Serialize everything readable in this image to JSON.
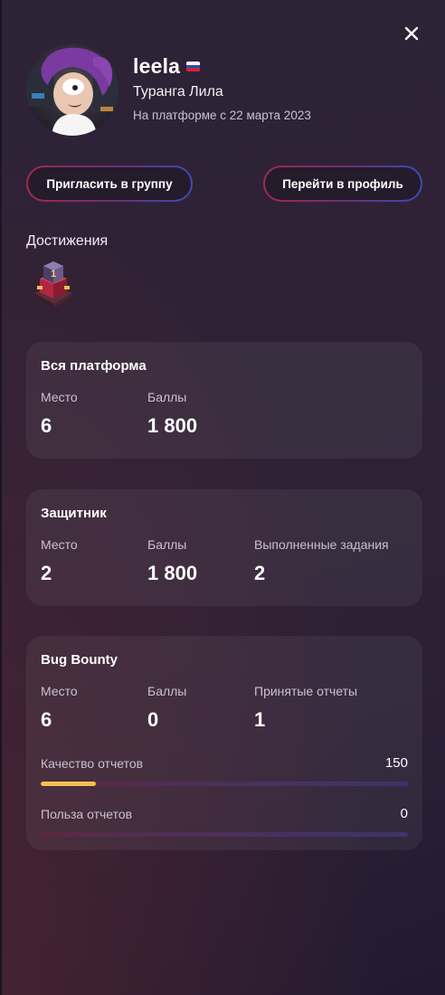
{
  "user": {
    "username": "leela",
    "full_name": "Туранга Лила",
    "since": "На платформе с 22 марта 2023",
    "country_flag_icon": "russia-flag-icon"
  },
  "actions": {
    "invite_label": "Пригласить в группу",
    "profile_label": "Перейти в профиль"
  },
  "achievements": {
    "title": "Достижения",
    "badges": [
      "rank-1-trophy-icon"
    ]
  },
  "cards": {
    "platform": {
      "title": "Вся платформа",
      "stats": [
        {
          "label": "Место",
          "value": "6"
        },
        {
          "label": "Баллы",
          "value": "1 800"
        }
      ]
    },
    "defender": {
      "title": "Защитник",
      "stats": [
        {
          "label": "Место",
          "value": "2"
        },
        {
          "label": "Баллы",
          "value": "1 800"
        },
        {
          "label": "Выполненные задания",
          "value": "2"
        }
      ]
    },
    "bugbounty": {
      "title": "Bug Bounty",
      "stats": [
        {
          "label": "Место",
          "value": "6"
        },
        {
          "label": "Баллы",
          "value": "0"
        },
        {
          "label": "Принятые отчеты",
          "value": "1"
        }
      ],
      "metrics": [
        {
          "label": "Качество отчетов",
          "value": "150",
          "progress": 0.15
        },
        {
          "label": "Польза отчетов",
          "value": "0",
          "progress": 0
        }
      ]
    }
  },
  "colors": {
    "progress_fill": "#f2c14e",
    "accent_red": "#a02a4a",
    "accent_blue": "#3d4bb6"
  }
}
